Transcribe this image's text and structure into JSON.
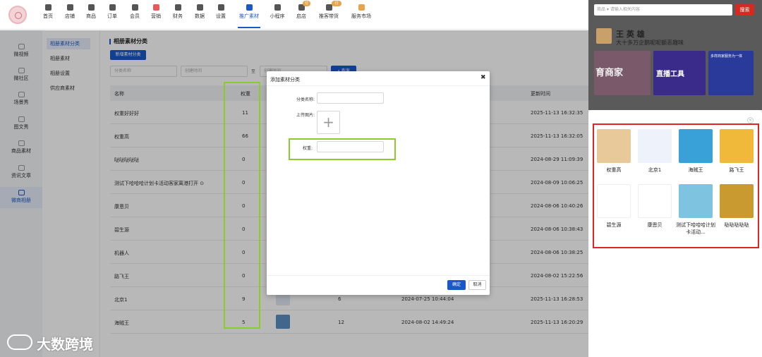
{
  "top_nav": [
    {
      "label": "首页",
      "icon": "home-icon"
    },
    {
      "label": "店铺",
      "icon": "shop-icon"
    },
    {
      "label": "商品",
      "icon": "goods-icon"
    },
    {
      "label": "订单",
      "icon": "order-icon"
    },
    {
      "label": "会员",
      "icon": "member-icon"
    },
    {
      "label": "营销",
      "icon": "marketing-icon"
    },
    {
      "label": "财务",
      "icon": "finance-icon"
    },
    {
      "label": "数据",
      "icon": "data-icon"
    },
    {
      "label": "设置",
      "icon": "settings-icon"
    },
    {
      "label": "推广素材",
      "icon": "share-icon",
      "active": true
    },
    {
      "label": "小程序",
      "icon": "miniapp-icon"
    },
    {
      "label": "启店",
      "icon": "store-icon",
      "badge": "付费"
    },
    {
      "label": "推客带货",
      "icon": "promoter-icon",
      "badge": "付费"
    },
    {
      "label": "服务市场",
      "icon": "market-icon"
    }
  ],
  "left_nav": [
    {
      "label": "微视频"
    },
    {
      "label": "微社区"
    },
    {
      "label": "场景秀"
    },
    {
      "label": "图文秀"
    },
    {
      "label": "商品素材"
    },
    {
      "label": "资讯文章"
    },
    {
      "label": "微商相册",
      "active": true
    }
  ],
  "sub_nav": [
    {
      "label": "相册素材分类",
      "active": true
    },
    {
      "label": "相册素材"
    },
    {
      "label": "相册设置"
    },
    {
      "label": "供应商素材"
    }
  ],
  "page": {
    "title": "相册素材分类",
    "new_button": "新增素材分类",
    "filters": {
      "name_placeholder": "分类名称",
      "start_placeholder": "创建时间",
      "to": "至",
      "end_placeholder": "创建时间",
      "search": "查询"
    },
    "columns": {
      "name": "名称",
      "weight": "权重",
      "update_time": "更新时间"
    },
    "rows": [
      {
        "name": "权重好好好",
        "weight": "11",
        "count": "",
        "create_time": "",
        "update_time": "2025-11-13 16:32:35"
      },
      {
        "name": "权重高",
        "weight": "66",
        "count": "",
        "create_time": "",
        "update_time": "2025-11-13 16:32:05"
      },
      {
        "name": "哒哒哒哒哒",
        "weight": "0",
        "count": "",
        "create_time": "",
        "update_time": "2024-08-29 11:09:39"
      },
      {
        "name": "测试下哈哈哈计划卡活动客家离港打开 ⊙",
        "weight": "0",
        "count": "",
        "create_time": "",
        "update_time": "2024-08-09 10:06:25"
      },
      {
        "name": "康恩贝",
        "weight": "0",
        "count": "",
        "create_time": "",
        "update_time": "2024-08-06 10:40:26"
      },
      {
        "name": "碧生源",
        "weight": "0",
        "count": "",
        "create_time": "",
        "update_time": "2024-08-06 10:38:43"
      },
      {
        "name": "机器人",
        "weight": "0",
        "count": "",
        "create_time": "",
        "update_time": "2024-08-06 10:38:25"
      },
      {
        "name": "路飞王",
        "weight": "0",
        "count": "",
        "create_time": "",
        "update_time": "2024-08-02 15:22:56"
      },
      {
        "name": "北京1",
        "weight": "9",
        "count": "6",
        "create_time": "2024-07-25 10:44:04",
        "update_time": "2025-11-13 16:28:53"
      },
      {
        "name": "海贼王",
        "weight": "5",
        "count": "12",
        "create_time": "2024-08-02 14:49:24",
        "update_time": "2025-11-13 16:20:29"
      }
    ]
  },
  "modal": {
    "title": "添加素材分类",
    "name_label": "分类名称:",
    "upload_label": "上传图片:",
    "weight_label": "权重:",
    "ok": "确定",
    "cancel": "取消"
  },
  "watermark": "大数跨境",
  "preview": {
    "search_category": "商品 ▾",
    "search_placeholder": "请输入相关内容",
    "search_button": "搜索",
    "profile_name": "王 英 雄",
    "profile_desc": "大十多万企鹅呢呢额恶趣味",
    "banner_texts": [
      "育商家",
      "直播工具",
      "多样商家服务为一体"
    ],
    "items": [
      {
        "label": "权重高",
        "color": "#e8c99a"
      },
      {
        "label": "北京1",
        "color": "#eef2fb"
      },
      {
        "label": "海贼王",
        "color": "#3aa0d8"
      },
      {
        "label": "路飞王",
        "color": "#f0b93a"
      },
      {
        "label": "碧生源",
        "color": "#ffffff"
      },
      {
        "label": "康恩贝",
        "color": "#ffffff"
      },
      {
        "label": "测试下哈哈哈计划卡活动...",
        "color": "#7ec3e0"
      },
      {
        "label": "哒哒哒哒哒",
        "color": "#c89a30"
      }
    ]
  },
  "colors": {
    "accent": "#1a58c8",
    "highlight_green": "#8ccc2a",
    "highlight_red": "#e02424"
  }
}
